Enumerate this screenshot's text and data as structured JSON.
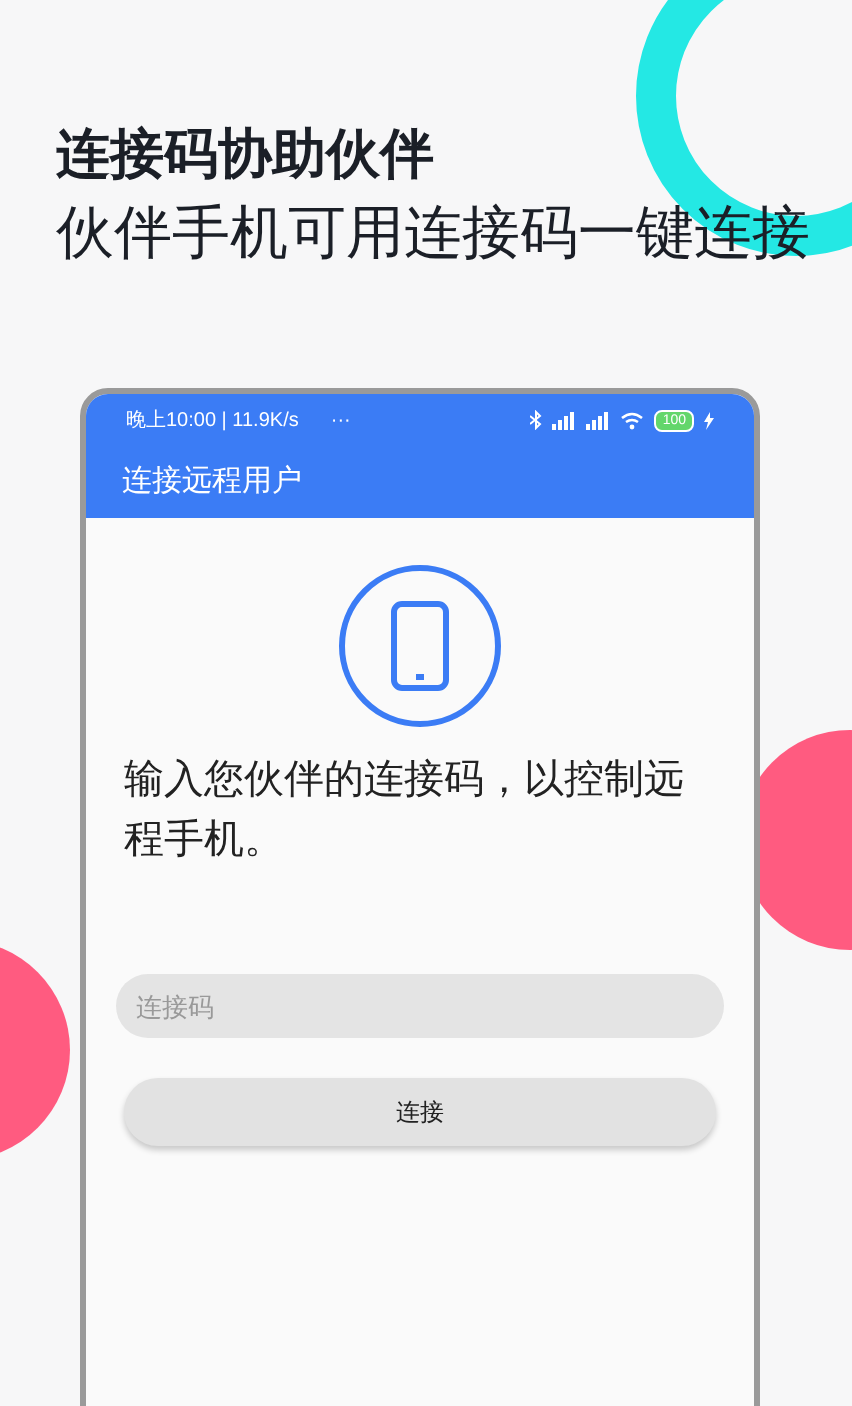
{
  "headline": "连接码协助伙伴",
  "subheadline": "伙伴手机可用连接码一键连接",
  "phone": {
    "status_bar": {
      "time": "晚上10:00 | 11.9K/s",
      "dots": "···",
      "battery": "100"
    },
    "app_bar": {
      "title": "连接远程用户"
    },
    "instruction": "输入您伙伴的连接码，以控制远程手机。",
    "code_field": {
      "placeholder": "连接码"
    },
    "connect_button": {
      "label": "连接"
    }
  }
}
